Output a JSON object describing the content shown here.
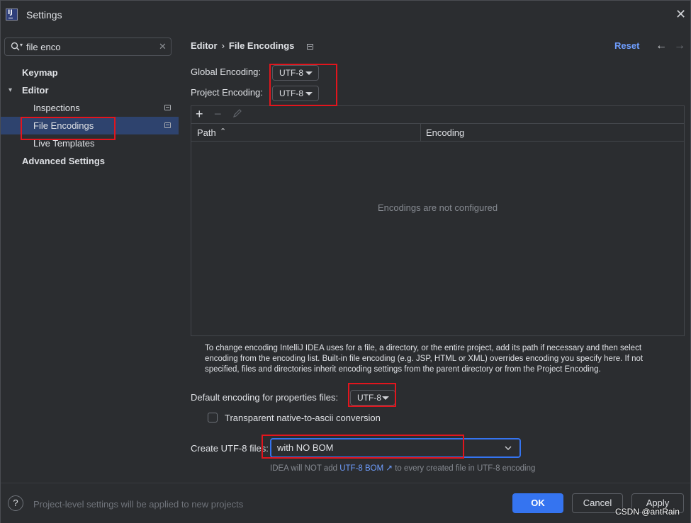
{
  "window": {
    "title": "Settings",
    "close_glyph": "✕",
    "logo_text": "IJ"
  },
  "search": {
    "value": "file enco",
    "clear_glyph": "✕"
  },
  "sidebar": {
    "items": [
      {
        "label": "Keymap"
      },
      {
        "label": "Editor"
      },
      {
        "label": "Inspections"
      },
      {
        "label": "File Encodings"
      },
      {
        "label": "Live Templates"
      },
      {
        "label": "Advanced Settings"
      }
    ]
  },
  "header": {
    "crumb_parent": "Editor",
    "crumb_sep": "›",
    "crumb_current": "File Encodings",
    "reset": "Reset",
    "back_glyph": "←",
    "forward_glyph": "→"
  },
  "encoding": {
    "global_label": "Global Encoding:",
    "global_value": "UTF-8",
    "project_label": "Project Encoding:",
    "project_value": "UTF-8"
  },
  "table": {
    "add_glyph": "+",
    "remove_glyph": "−",
    "col_path": "Path",
    "sort_glyph": "⌃",
    "col_encoding": "Encoding",
    "empty_text": "Encodings are not configured"
  },
  "help_text": "To change encoding IntelliJ IDEA uses for a file, a directory, or the entire project, add its path if necessary and then select encoding from the encoding list. Built-in file encoding (e.g. JSP, HTML or XML) overrides encoding you specify here. If not specified, files and directories inherit encoding settings from the parent directory or from the Project Encoding.",
  "properties": {
    "label": "Default encoding for properties files:",
    "value": "UTF-8",
    "transparent_label": "Transparent native-to-ascii conversion"
  },
  "utf8": {
    "label": "Create UTF-8 files:",
    "value": "with NO BOM",
    "hint_prefix": "IDEA will NOT add ",
    "hint_link": "UTF-8 BOM",
    "hint_arrow": "↗",
    "hint_suffix": " to every created file in UTF-8 encoding"
  },
  "footer": {
    "help_glyph": "?",
    "note": "Project-level settings will be applied to new projects",
    "ok": "OK",
    "cancel": "Cancel",
    "apply": "Apply"
  },
  "watermark": "CSDN @antRain",
  "colors": {
    "accent": "#3574f0",
    "link": "#6f9eff",
    "selection": "#2e436e",
    "annotation": "#e2151d",
    "background": "#2b2d30"
  }
}
